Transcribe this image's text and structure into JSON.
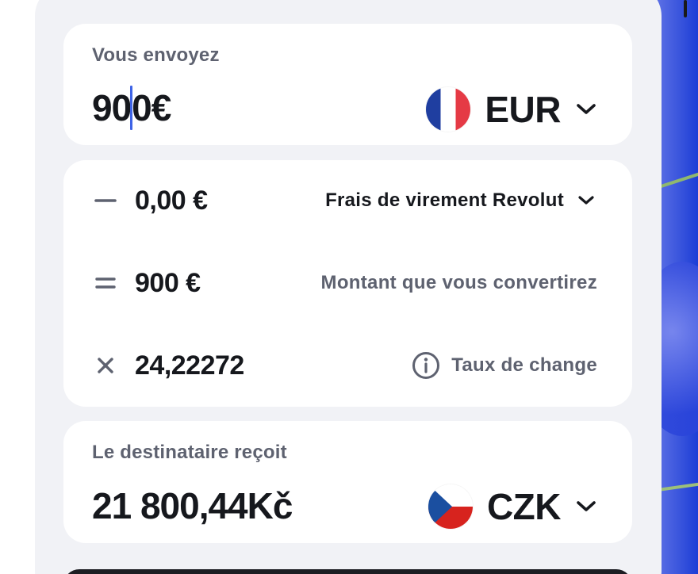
{
  "send": {
    "label": "Vous envoyez",
    "amount_before_caret": "90",
    "amount_after_caret": "0€",
    "currency_code": "EUR",
    "flag_icon": "france-flag-icon"
  },
  "details": {
    "fee": {
      "operator": "minus-icon",
      "value": "0,00 €",
      "label": "Frais de virement Revolut"
    },
    "converted": {
      "operator": "equals-icon",
      "value": "900 €",
      "label": "Montant que vous convertirez"
    },
    "rate": {
      "operator": "multiply-icon",
      "value": "24,22272",
      "label": "Taux de change"
    }
  },
  "receive": {
    "label": "Le destinataire reçoit",
    "amount": "21 800,44Kč",
    "currency_code": "CZK",
    "flag_icon": "czech-flag-icon"
  },
  "colors": {
    "caret": "#3e63e6",
    "text_primary": "#16181d",
    "text_secondary": "#5e6270",
    "sheet_bg": "#f1f2f6"
  }
}
